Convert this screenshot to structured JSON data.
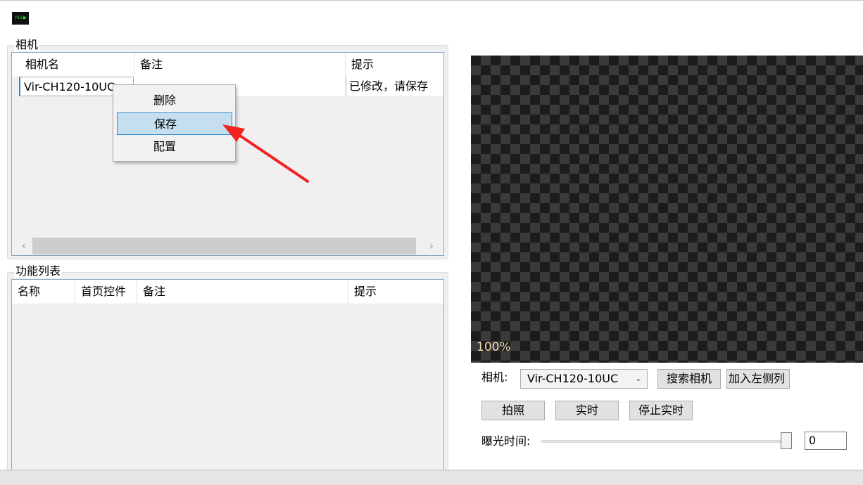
{
  "app": {
    "icon_text": "PLC■"
  },
  "camera_group": {
    "title": "相机",
    "columns": [
      "相机名",
      "备注",
      "提示"
    ],
    "rows": [
      {
        "name": "Vir-CH120-10UC",
        "note": "",
        "hint": "已修改，请保存"
      }
    ],
    "scroll_left": "‹",
    "scroll_right": "›"
  },
  "context_menu": {
    "items": [
      {
        "label": "删除"
      },
      {
        "label": "保存",
        "selected": true
      },
      {
        "label": "配置"
      }
    ]
  },
  "function_group": {
    "title": "功能列表",
    "columns": [
      "名称",
      "首页控件",
      "备注",
      "提示"
    ]
  },
  "preview": {
    "zoom": "100%"
  },
  "controls": {
    "camera_label": "相机:",
    "camera_selected": "Vir-CH120-10UC",
    "search_button": "搜索相机",
    "add_button": "加入左侧列",
    "capture_button": "拍照",
    "live_button": "实时",
    "stop_live_button": "停止实时",
    "exposure_label": "曝光时间:",
    "exposure_value": "0",
    "exposure_level": 1.0
  },
  "colors": {
    "menu_highlight": "#c5dff0",
    "menu_border": "#2a8ad4",
    "annotation_arrow": "#f22323"
  },
  "icons": {
    "combo_chevron": "chevron-down-icon"
  }
}
